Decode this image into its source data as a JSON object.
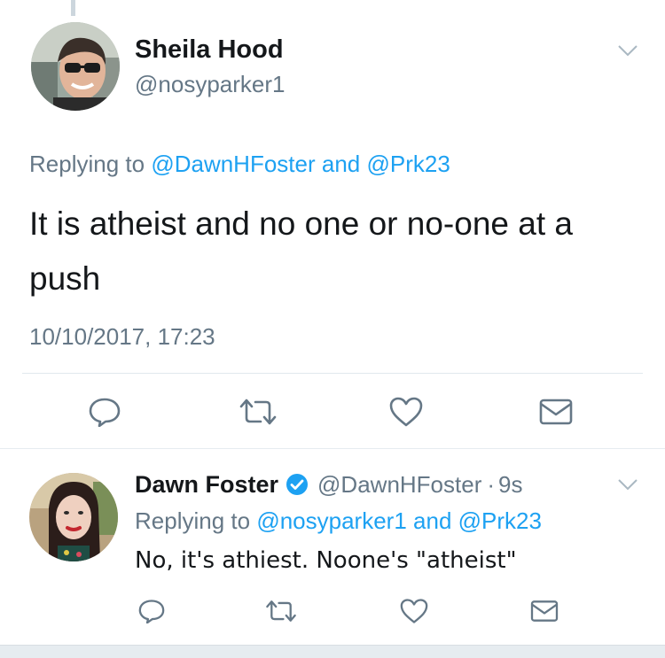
{
  "main_tweet": {
    "author_name": "Sheila Hood",
    "author_handle": "@nosyparker1",
    "replying_prefix": "Replying to",
    "replying_user1": "@DawnHFoster",
    "replying_and": "and",
    "replying_user2": "@Prk23",
    "text": "It is atheist and no one or no-one at a push",
    "timestamp": "10/10/2017, 17:23",
    "avatar_icon": "profile-photo",
    "actions": [
      "reply-icon",
      "retweet-icon",
      "like-icon",
      "message-icon"
    ]
  },
  "reply_tweet": {
    "author_name": "Dawn Foster",
    "verified": true,
    "author_handle": "@DawnHFoster",
    "separator": "·",
    "time_ago": "9s",
    "replying_prefix": "Replying to",
    "replying_user1": "@nosyparker1",
    "replying_and": "and",
    "replying_user2": "@Prk23",
    "text": "No, it's athiest. Noone's \"atheist\"",
    "avatar_icon": "profile-photo",
    "actions": [
      "reply-icon",
      "retweet-icon",
      "like-icon",
      "message-icon"
    ]
  },
  "colors": {
    "link_blue": "#1da1f2",
    "muted_gray": "#657786",
    "text_dark": "#14171a",
    "divider": "#e1e8ed"
  }
}
